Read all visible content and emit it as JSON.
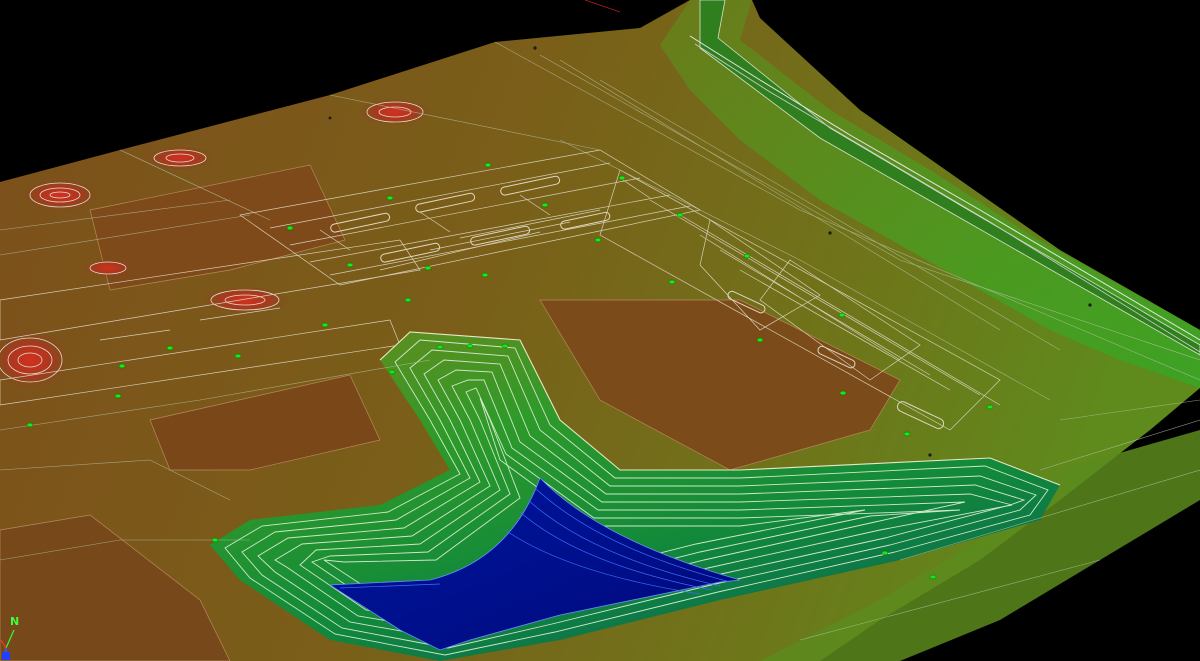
{
  "viewport": {
    "background": "#000000",
    "mode": "3d-perspective-surface-view"
  },
  "surface": {
    "display_style": "elevation-banded",
    "elevation_colors": {
      "highest": "#c42a1f",
      "high": "#8e5a1c",
      "mid_high": "#7b6216",
      "mid": "#6f7c16",
      "mid_low": "#3f9b1f",
      "low": "#1c8f2f",
      "lowest": "#000f86"
    },
    "contour_color": "#c9c9c9",
    "triangulation_color": "#b8c4a6"
  },
  "features": {
    "detention_basin": "basin-bottom",
    "parking_lots": "parking-islands",
    "building_pads": "building-pad",
    "mounds": "landscape-mound",
    "road": "access-road",
    "drainage_structures": "inlet-marker"
  },
  "compass": {
    "north_label": "N",
    "axis_x_color": "#ff3030",
    "axis_y_color": "#30ff30",
    "axis_z_color": "#3060ff"
  }
}
